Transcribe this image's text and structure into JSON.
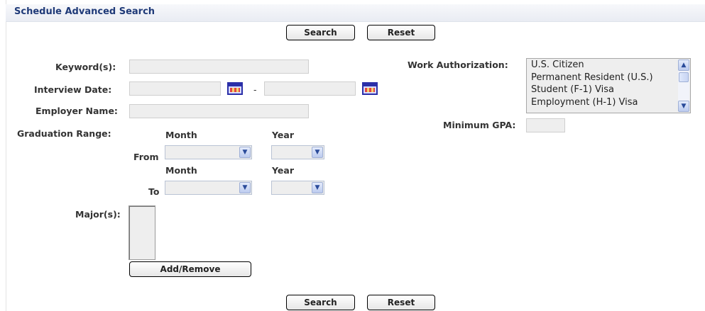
{
  "header": {
    "title": "Schedule Advanced Search"
  },
  "buttons": {
    "search": "Search",
    "reset": "Reset",
    "add_remove": "Add/Remove"
  },
  "labels": {
    "keywords": "Keyword(s):",
    "interview_date": "Interview Date:",
    "date_separator": "-",
    "employer_name": "Employer Name:",
    "graduation_range": "Graduation Range:",
    "month": "Month",
    "year": "Year",
    "from": "From",
    "to": "To",
    "majors": "Major(s):",
    "work_authorization": "Work Authorization:",
    "minimum_gpa": "Minimum GPA:"
  },
  "fields": {
    "keywords": "",
    "interview_date_start": "",
    "interview_date_end": "",
    "employer_name": "",
    "minimum_gpa": "",
    "from_month": "",
    "from_year": "",
    "to_month": "",
    "to_year": ""
  },
  "work_authorization": {
    "options": [
      "U.S. Citizen",
      "Permanent Resident (U.S.)",
      "Student (F-1) Visa",
      "Employment (H-1) Visa"
    ]
  },
  "icons": {
    "calendar": "calendar-icon",
    "dropdown": "chevron-down-icon",
    "scroll_up": "chevron-up-icon"
  },
  "colors": {
    "header_title": "#1f3a78",
    "calendar": "#2b2fa8"
  }
}
